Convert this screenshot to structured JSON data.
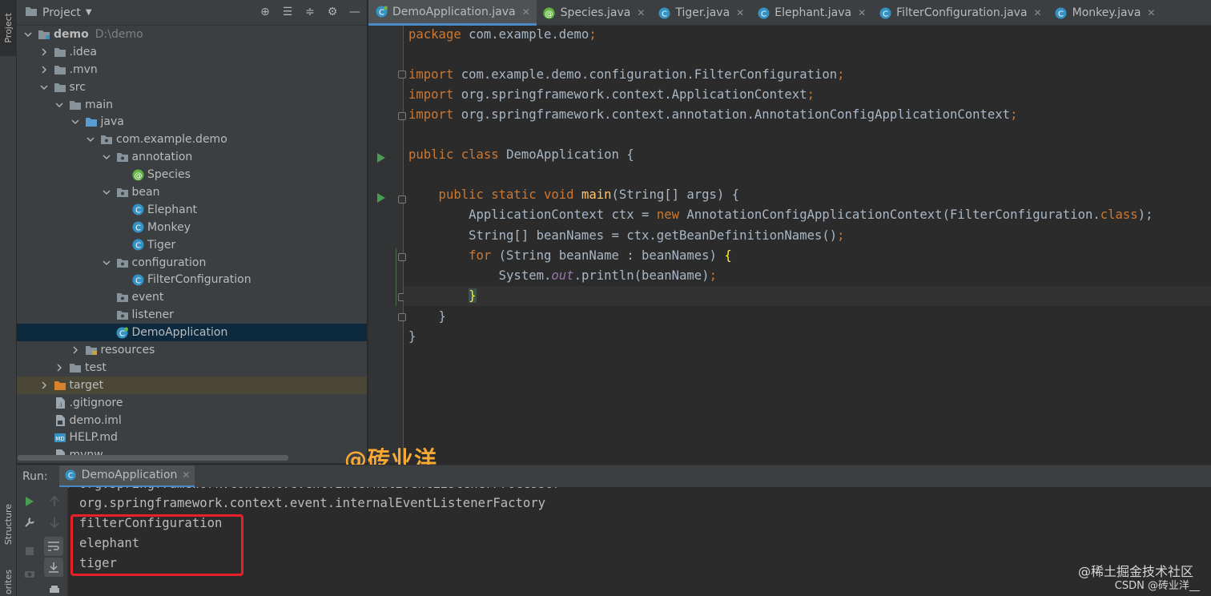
{
  "left_strip": {
    "project_tab": "Project",
    "structure_tab": "Structure",
    "favorites_tab": "orites"
  },
  "project_panel": {
    "title": "Project",
    "tree": [
      {
        "label": "demo",
        "extra": "D:\\demo",
        "depth": 0,
        "arrow": "down",
        "icon": "module",
        "bold": true
      },
      {
        "label": ".idea",
        "depth": 1,
        "arrow": "right",
        "icon": "folder"
      },
      {
        "label": ".mvn",
        "depth": 1,
        "arrow": "right",
        "icon": "folder"
      },
      {
        "label": "src",
        "depth": 1,
        "arrow": "down",
        "icon": "folder"
      },
      {
        "label": "main",
        "depth": 2,
        "arrow": "down",
        "icon": "folder"
      },
      {
        "label": "java",
        "depth": 3,
        "arrow": "down",
        "icon": "folder-blue"
      },
      {
        "label": "com.example.demo",
        "depth": 4,
        "arrow": "down",
        "icon": "package"
      },
      {
        "label": "annotation",
        "depth": 5,
        "arrow": "down",
        "icon": "package"
      },
      {
        "label": "Species",
        "depth": 6,
        "arrow": "none",
        "icon": "annotation-class"
      },
      {
        "label": "bean",
        "depth": 5,
        "arrow": "down",
        "icon": "package"
      },
      {
        "label": "Elephant",
        "depth": 6,
        "arrow": "none",
        "icon": "class"
      },
      {
        "label": "Monkey",
        "depth": 6,
        "arrow": "none",
        "icon": "class"
      },
      {
        "label": "Tiger",
        "depth": 6,
        "arrow": "none",
        "icon": "class"
      },
      {
        "label": "configuration",
        "depth": 5,
        "arrow": "down",
        "icon": "package"
      },
      {
        "label": "FilterConfiguration",
        "depth": 6,
        "arrow": "none",
        "icon": "class"
      },
      {
        "label": "event",
        "depth": 5,
        "arrow": "none",
        "icon": "package"
      },
      {
        "label": "listener",
        "depth": 5,
        "arrow": "none",
        "icon": "package"
      },
      {
        "label": "DemoApplication",
        "depth": 5,
        "arrow": "none",
        "icon": "spring-class",
        "selected": true
      },
      {
        "label": "resources",
        "depth": 3,
        "arrow": "right",
        "icon": "folder-res"
      },
      {
        "label": "test",
        "depth": 2,
        "arrow": "right",
        "icon": "folder"
      },
      {
        "label": "target",
        "depth": 1,
        "arrow": "right",
        "icon": "folder-orange",
        "target": true
      },
      {
        "label": ".gitignore",
        "depth": 1,
        "arrow": "none",
        "icon": "file-ignore"
      },
      {
        "label": "demo.iml",
        "depth": 1,
        "arrow": "none",
        "icon": "file-iml"
      },
      {
        "label": "HELP.md",
        "depth": 1,
        "arrow": "none",
        "icon": "file-md"
      },
      {
        "label": "mvnw",
        "depth": 1,
        "arrow": "none",
        "icon": "file"
      }
    ]
  },
  "editor_tabs": [
    {
      "label": "DemoApplication.java",
      "icon": "spring-class",
      "active": true,
      "closable": true
    },
    {
      "label": "Species.java",
      "icon": "annotation-class",
      "closable": true
    },
    {
      "label": "Tiger.java",
      "icon": "class",
      "closable": true
    },
    {
      "label": "Elephant.java",
      "icon": "class",
      "closable": true
    },
    {
      "label": "FilterConfiguration.java",
      "icon": "class",
      "closable": true
    },
    {
      "label": "Monkey.java",
      "icon": "class",
      "closable": true
    }
  ],
  "code_lines": [
    [
      {
        "t": "package ",
        "c": "kw"
      },
      {
        "t": "com.example.demo"
      },
      {
        "t": ";",
        "c": "kw"
      }
    ],
    [],
    [
      {
        "t": "import ",
        "c": "kw"
      },
      {
        "t": "com.example.demo.configuration.FilterConfiguration"
      },
      {
        "t": ";",
        "c": "kw"
      }
    ],
    [
      {
        "t": "import ",
        "c": "kw"
      },
      {
        "t": "org.springframework.context.ApplicationContext"
      },
      {
        "t": ";",
        "c": "kw"
      }
    ],
    [
      {
        "t": "import ",
        "c": "kw"
      },
      {
        "t": "org.springframework.context.annotation.AnnotationConfigApplicationContext"
      },
      {
        "t": ";",
        "c": "kw"
      }
    ],
    [],
    [
      {
        "t": "public class ",
        "c": "kw"
      },
      {
        "t": "DemoApplication {"
      }
    ],
    [],
    [
      {
        "t": "    public static void ",
        "c": "kw"
      },
      {
        "t": "main",
        "c": "fn"
      },
      {
        "t": "(String[] args) {"
      }
    ],
    [
      {
        "t": "        ApplicationContext ctx = "
      },
      {
        "t": "new ",
        "c": "kw"
      },
      {
        "t": "AnnotationConfigApplicationContext(FilterConfiguration."
      },
      {
        "t": "class",
        "c": "kw"
      },
      {
        "t": ");"
      }
    ],
    [
      {
        "t": "        String[] beanNames = ctx.getBeanDefinitionNames()"
      },
      {
        "t": ";",
        "c": "kw"
      }
    ],
    [
      {
        "t": "        for ",
        "c": "kw"
      },
      {
        "t": "(String beanName : beanNames) "
      },
      {
        "t": "{",
        "c": "brace-y"
      }
    ],
    [
      {
        "t": "            System."
      },
      {
        "t": "out",
        "c": "st"
      },
      {
        "t": ".println(beanName)"
      },
      {
        "t": ";",
        "c": "kw"
      }
    ],
    [
      {
        "t": "        "
      },
      {
        "t": "}",
        "c": "brace-hl"
      }
    ],
    [
      {
        "t": "    }"
      }
    ],
    [
      {
        "t": "}"
      }
    ]
  ],
  "watermark": "@砖业洋__",
  "run_panel": {
    "label": "Run:",
    "tab": "DemoApplication",
    "console_lines": [
      "org.springframework.context.event.internalEventListenerProcessor",
      "org.springframework.context.event.internalEventListenerFactory",
      "filterConfiguration",
      "elephant",
      "tiger"
    ]
  },
  "footer": {
    "line1": "@稀土掘金技术社区",
    "line2": "CSDN @砖业洋__"
  },
  "colors": {
    "accent": "#4a88c7",
    "highlight_box": "#e8202a",
    "watermark": "#f7a934"
  }
}
